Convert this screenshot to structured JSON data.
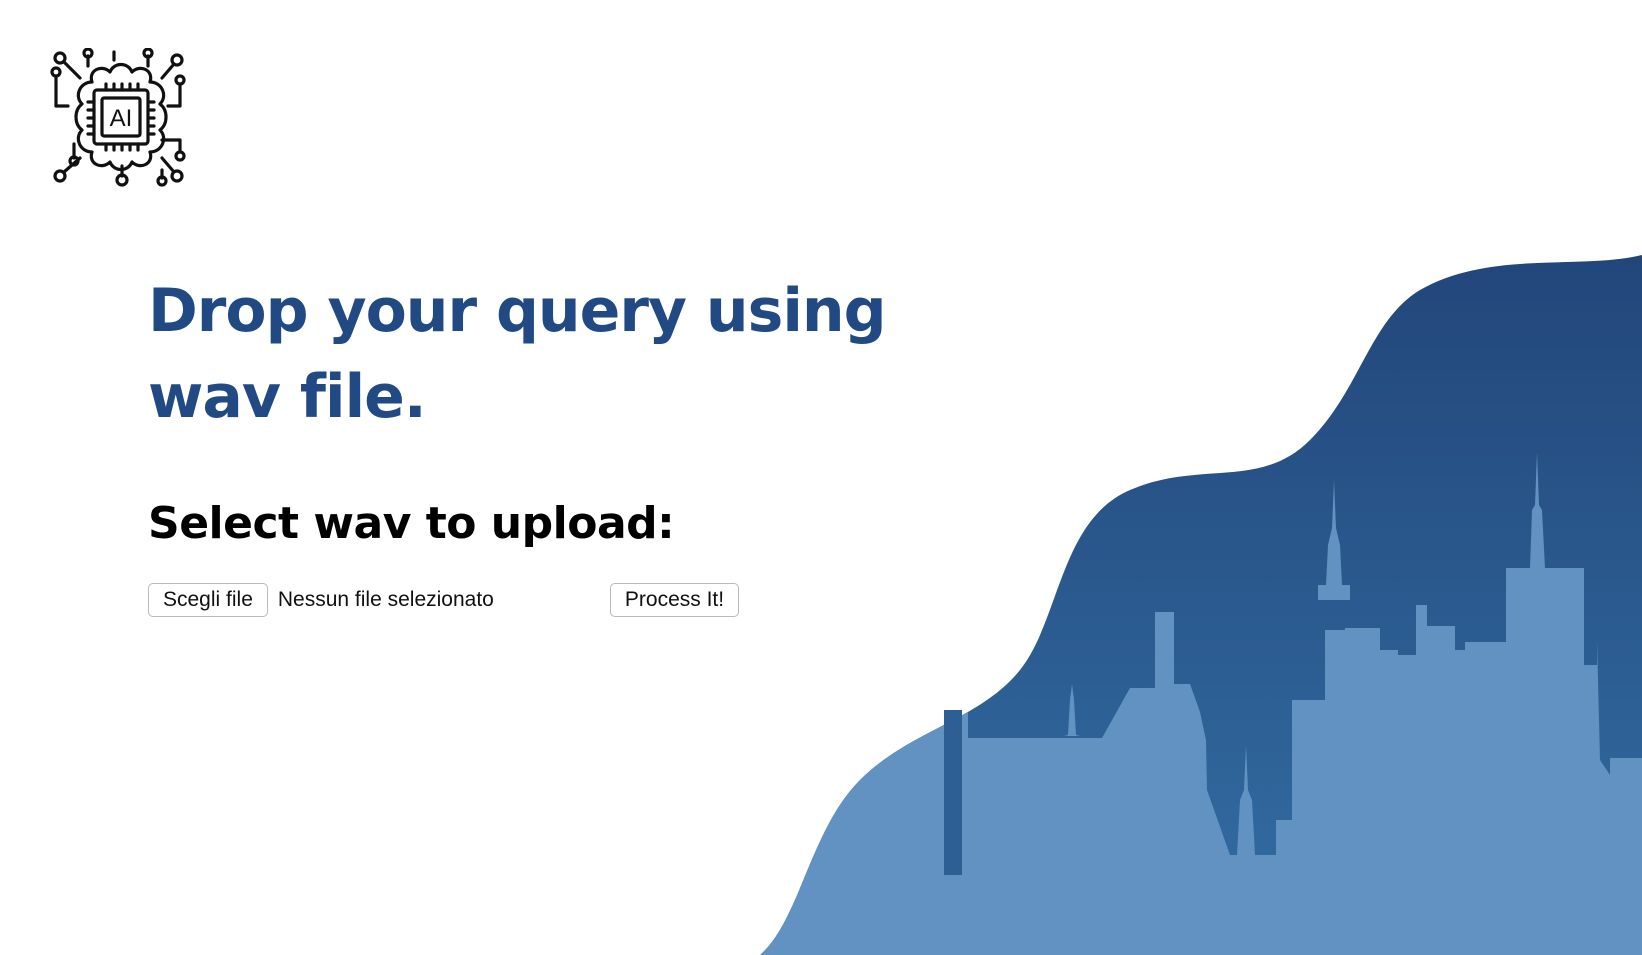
{
  "logo": {
    "icon": "ai-chip-cloud-icon",
    "chip_text": "AI"
  },
  "hero": {
    "title_line1": "Drop your query using",
    "title_line2": "wav file."
  },
  "upload": {
    "label": "Select wav to upload:",
    "choose_button": "Scegli file",
    "file_status": "Nessun file selezionato",
    "submit_button": "Process It!"
  },
  "colors": {
    "title": "#214a84",
    "wave_dark": "#234a7e",
    "wave_mid": "#2e6699",
    "city": "#6192c2"
  }
}
